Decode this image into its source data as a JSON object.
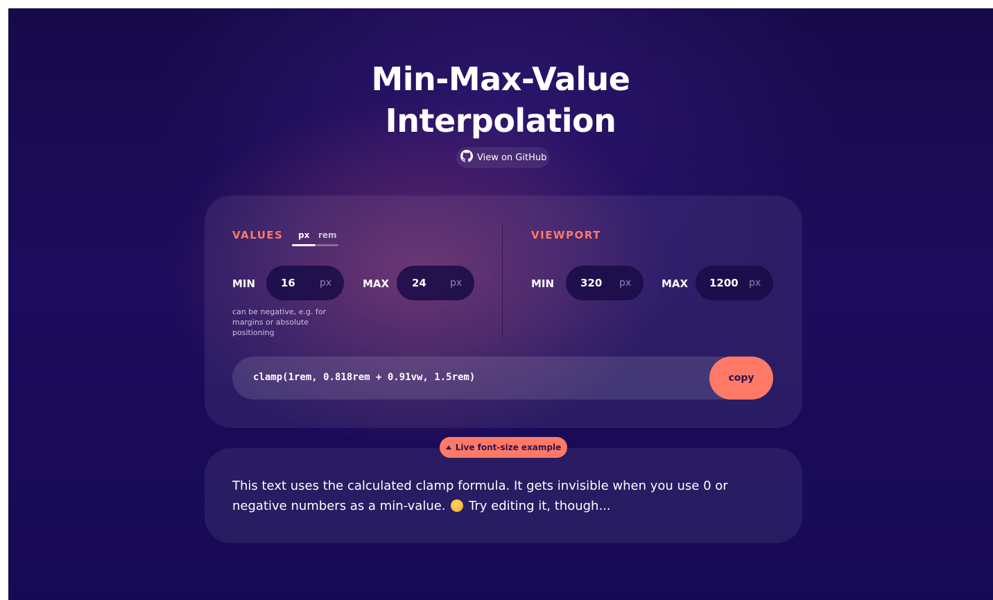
{
  "header": {
    "title_line1": "Min-Max-Value",
    "title_line2": "Interpolation",
    "github_label": "View on GitHub"
  },
  "values": {
    "label": "VALUES",
    "units": [
      "px",
      "rem"
    ],
    "active_unit": "px",
    "min_label": "MIN",
    "min_value": "16",
    "min_unit": "px",
    "max_label": "MAX",
    "max_value": "24",
    "max_unit": "px",
    "hint": "can be negative, e.g. for margins or absolute positioning"
  },
  "viewport": {
    "label": "VIEWPORT",
    "min_label": "MIN",
    "min_value": "320",
    "min_unit": "px",
    "max_label": "MAX",
    "max_value": "1200",
    "max_unit": "px"
  },
  "formula": {
    "text": "clamp(1rem, 0.818rem + 0.91vw, 1.5rem)",
    "copy_label": "copy"
  },
  "example": {
    "badge_label": "Live font-size example",
    "text_before": "This text uses the calculated clamp formula. It gets invisible when you use 0 or negative numbers as a min-value.",
    "emoji_icon": "face-emoji-icon",
    "text_after": "Try editing it, though..."
  },
  "colors": {
    "accent": "#ff7a66",
    "background": "#1c0c5c",
    "card": "rgba(255,255,255,0.07)"
  }
}
